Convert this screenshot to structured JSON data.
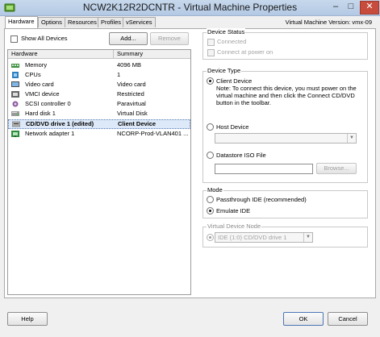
{
  "window": {
    "title": "NCW2K12R2DCNTR - Virtual Machine Properties",
    "minimize_glyph": "–",
    "maximize_glyph": "□",
    "close_glyph": "✕"
  },
  "tabs": [
    {
      "label": "Hardware",
      "active": true
    },
    {
      "label": "Options",
      "active": false
    },
    {
      "label": "Resources",
      "active": false
    },
    {
      "label": "Profiles",
      "active": false
    },
    {
      "label": "vServices",
      "active": false
    }
  ],
  "vm_version": "Virtual Machine Version: vmx-09",
  "hardware_panel": {
    "show_all_devices_label": "Show All Devices",
    "show_all_devices_checked": false,
    "add_label": "Add...",
    "remove_label": "Remove",
    "columns": [
      "Hardware",
      "Summary"
    ],
    "rows": [
      {
        "icon": "memory-icon",
        "name": "Memory",
        "summary": "4096 MB",
        "selected": false
      },
      {
        "icon": "cpu-icon",
        "name": "CPUs",
        "summary": "1",
        "selected": false
      },
      {
        "icon": "video-card-icon",
        "name": "Video card",
        "summary": "Video card",
        "selected": false
      },
      {
        "icon": "vmci-device-icon",
        "name": "VMCI device",
        "summary": "Restricted",
        "selected": false
      },
      {
        "icon": "scsi-controller-icon",
        "name": "SCSI controller 0",
        "summary": "Paravirtual",
        "selected": false
      },
      {
        "icon": "hard-disk-icon",
        "name": "Hard disk 1",
        "summary": "Virtual Disk",
        "selected": false
      },
      {
        "icon": "cd-dvd-drive-icon",
        "name": "CD/DVD drive 1 (edited)",
        "summary": "Client Device",
        "selected": true
      },
      {
        "icon": "network-adapter-icon",
        "name": "Network adapter 1",
        "summary": "NCORP-Prod-VLAN401 ...",
        "selected": false
      }
    ]
  },
  "device_status": {
    "legend": "Device Status",
    "connected_label": "Connected",
    "connected_checked": false,
    "connect_power_on_label": "Connect at power on",
    "connect_power_on_checked": false
  },
  "device_type": {
    "legend": "Device Type",
    "selected": "client_device",
    "client_device_label": "Client Device",
    "client_device_note": [
      "Note: To connect this device, you must power on the",
      "virtual machine and then click the Connect CD/DVD",
      "button in the toolbar."
    ],
    "host_device_label": "Host Device",
    "host_device_value": "",
    "datastore_iso_label": "Datastore ISO File",
    "datastore_iso_value": "",
    "browse_label": "Browse..."
  },
  "mode": {
    "legend": "Mode",
    "selected": "emulate_ide",
    "passthrough_label": "Passthrough IDE (recommended)",
    "emulate_label": "Emulate IDE"
  },
  "virtual_device_node": {
    "legend": "Virtual Device Node",
    "value": "IDE (1:0) CD/DVD drive 1"
  },
  "footer": {
    "help_label": "Help",
    "ok_label": "OK",
    "cancel_label": "Cancel"
  }
}
